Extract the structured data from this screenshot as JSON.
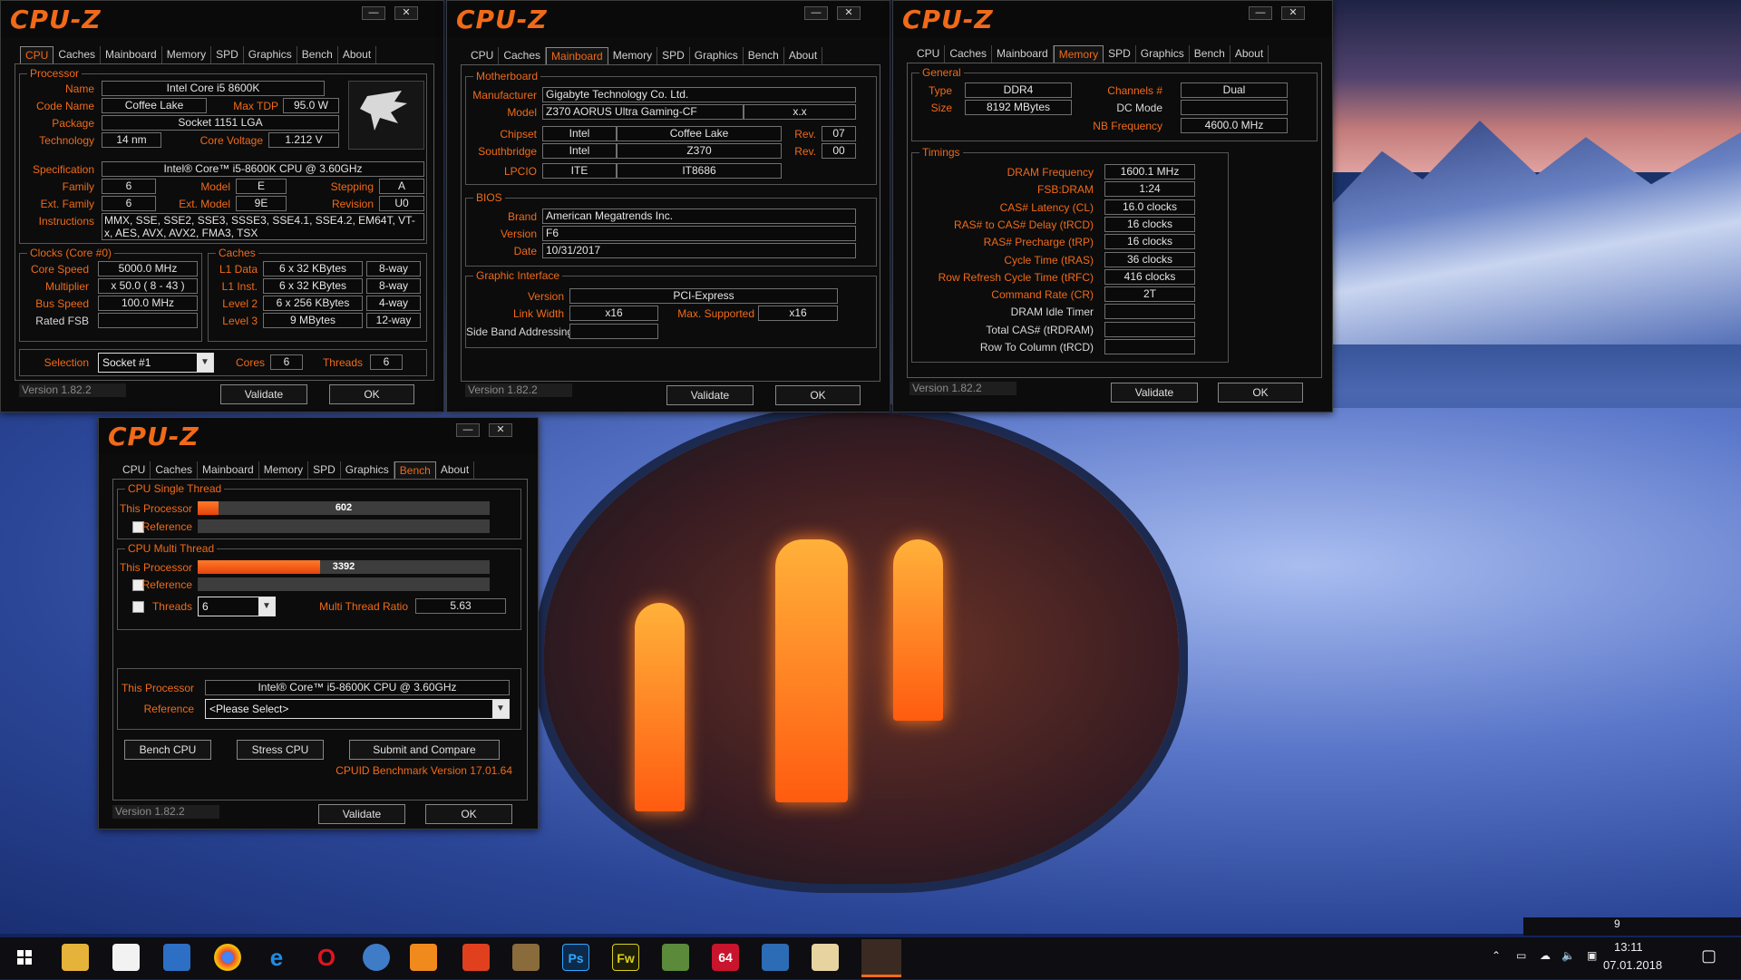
{
  "app": {
    "name": "CPU-Z",
    "version": "Version 1.82.2",
    "validate": "Validate",
    "ok": "OK",
    "min": "—",
    "close": "✕"
  },
  "tabs": [
    "CPU",
    "Caches",
    "Mainboard",
    "Memory",
    "SPD",
    "Graphics",
    "Bench",
    "About"
  ],
  "cpu": {
    "processor_title": "Processor",
    "name_l": "Name",
    "name": "Intel Core i5 8600K",
    "codename_l": "Code Name",
    "codename": "Coffee Lake",
    "maxtdp_l": "Max TDP",
    "maxtdp": "95.0 W",
    "package_l": "Package",
    "package": "Socket 1151 LGA",
    "tech_l": "Technology",
    "tech": "14 nm",
    "voltage_l": "Core Voltage",
    "voltage": "1.212 V",
    "spec_l": "Specification",
    "spec": "Intel® Core™ i5-8600K CPU @ 3.60GHz",
    "family_l": "Family",
    "family": "6",
    "model_l": "Model",
    "model": "E",
    "stepping_l": "Stepping",
    "stepping": "A",
    "extfamily_l": "Ext. Family",
    "extfamily": "6",
    "extmodel_l": "Ext. Model",
    "extmodel": "9E",
    "revision_l": "Revision",
    "revision": "U0",
    "instr_l": "Instructions",
    "instr": "MMX, SSE, SSE2, SSE3, SSSE3, SSE4.1, SSE4.2, EM64T, VT-x, AES, AVX, AVX2, FMA3, TSX",
    "clocks_title": "Clocks (Core #0)",
    "corespeed_l": "Core Speed",
    "corespeed": "5000.0 MHz",
    "mult_l": "Multiplier",
    "mult": "x 50.0 ( 8 - 43 )",
    "bus_l": "Bus Speed",
    "bus": "100.0 MHz",
    "fsb_l": "Rated FSB",
    "fsb": "",
    "caches_title": "Caches",
    "l1d_l": "L1 Data",
    "l1d": "6 x 32 KBytes",
    "l1d_w": "8-way",
    "l1i_l": "L1 Inst.",
    "l1i": "6 x 32 KBytes",
    "l1i_w": "8-way",
    "l2_l": "Level 2",
    "l2": "6 x 256 KBytes",
    "l2_w": "4-way",
    "l3_l": "Level 3",
    "l3": "9 MBytes",
    "l3_w": "12-way",
    "selection_l": "Selection",
    "selection": "Socket #1",
    "cores_l": "Cores",
    "cores": "6",
    "threads_l": "Threads",
    "threads": "6",
    "brand_logo": "AORUS"
  },
  "mainboard": {
    "mb_title": "Motherboard",
    "manu_l": "Manufacturer",
    "manu": "Gigabyte Technology Co. Ltd.",
    "model_l": "Model",
    "model": "Z370 AORUS Ultra Gaming-CF",
    "model_rev": "x.x",
    "chipset_l": "Chipset",
    "chipset_v": "Intel",
    "chipset_n": "Coffee Lake",
    "chipset_rev_l": "Rev.",
    "chipset_rev": "07",
    "south_l": "Southbridge",
    "south_v": "Intel",
    "south_n": "Z370",
    "south_rev_l": "Rev.",
    "south_rev": "00",
    "lpcio_l": "LPCIO",
    "lpcio_v": "ITE",
    "lpcio_n": "IT8686",
    "bios_title": "BIOS",
    "brand_l": "Brand",
    "brand": "American Megatrends Inc.",
    "version_l": "Version",
    "version": "F6",
    "date_l": "Date",
    "date": "10/31/2017",
    "gi_title": "Graphic Interface",
    "gi_version_l": "Version",
    "gi_version": "PCI-Express",
    "linkwidth_l": "Link Width",
    "linkwidth": "x16",
    "maxsup_l": "Max. Supported",
    "maxsup": "x16",
    "sideband_l": "Side Band Addressing",
    "sideband": ""
  },
  "memory": {
    "general_title": "General",
    "type_l": "Type",
    "type": "DDR4",
    "channels_l": "Channels #",
    "channels": "Dual",
    "size_l": "Size",
    "size": "8192 MBytes",
    "dcmode_l": "DC Mode",
    "dcmode": "",
    "nbfreq_l": "NB Frequency",
    "nbfreq": "4600.0 MHz",
    "timings_title": "Timings",
    "rows": [
      {
        "l": "DRAM Frequency",
        "v": "1600.1 MHz",
        "w": false
      },
      {
        "l": "FSB:DRAM",
        "v": "1:24",
        "w": false
      },
      {
        "l": "CAS# Latency (CL)",
        "v": "16.0 clocks",
        "w": false
      },
      {
        "l": "RAS# to CAS# Delay (tRCD)",
        "v": "16 clocks",
        "w": false
      },
      {
        "l": "RAS# Precharge (tRP)",
        "v": "16 clocks",
        "w": false
      },
      {
        "l": "Cycle Time (tRAS)",
        "v": "36 clocks",
        "w": false
      },
      {
        "l": "Row Refresh Cycle Time (tRFC)",
        "v": "416 clocks",
        "w": false
      },
      {
        "l": "Command Rate (CR)",
        "v": "2T",
        "w": false
      },
      {
        "l": "DRAM Idle Timer",
        "v": "",
        "w": true
      },
      {
        "l": "Total CAS# (tRDRAM)",
        "v": "",
        "w": true
      },
      {
        "l": "Row To Column (tRCD)",
        "v": "",
        "w": true
      }
    ]
  },
  "bench": {
    "single_title": "CPU Single Thread",
    "this_l": "This Processor",
    "single_score": "602",
    "single_frac": 0.07,
    "ref_l": "Reference",
    "multi_title": "CPU Multi Thread",
    "multi_score": "3392",
    "multi_frac": 0.42,
    "threads_l": "Threads",
    "threads": "6",
    "ratio_l": "Multi Thread Ratio",
    "ratio": "5.63",
    "proc_l": "This Processor",
    "proc": "Intel® Core™ i5-8600K CPU @ 3.60GHz",
    "refsel_l": "Reference",
    "refsel": "<Please Select>",
    "bench_btn": "Bench CPU",
    "stress_btn": "Stress CPU",
    "submit_btn": "Submit and Compare",
    "bench_ver": "CPUID Benchmark Version 17.01.64"
  },
  "taskbar": {
    "time": "13:11",
    "date": "07.01.2018",
    "tray_num": "9",
    "app_64": "64",
    "app_ps": "Ps",
    "app_fw": "Fw"
  }
}
